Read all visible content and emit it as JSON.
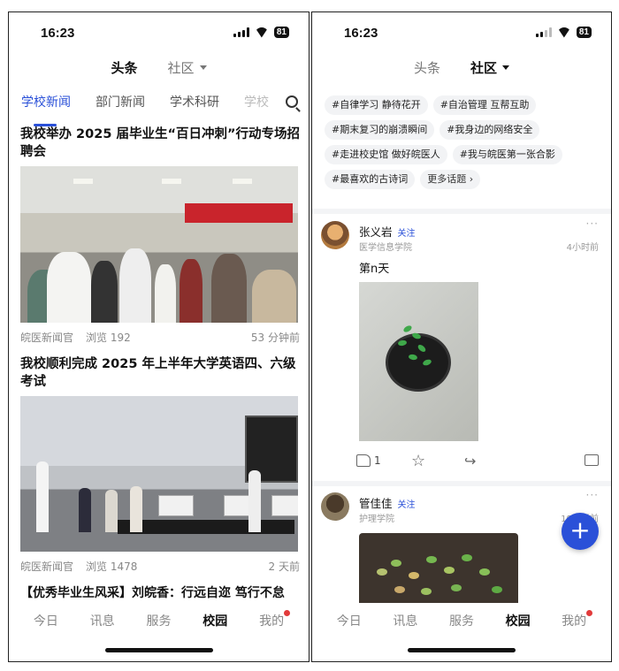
{
  "status_bar": {
    "time": "16:23",
    "battery": "81"
  },
  "left": {
    "top_tabs": [
      {
        "label": "头条"
      },
      {
        "label": "社区"
      }
    ],
    "sub_tabs": [
      {
        "label": "学校新闻"
      },
      {
        "label": "部门新闻"
      },
      {
        "label": "学术科研"
      },
      {
        "label": "学校"
      }
    ],
    "articles": [
      {
        "title": "我校举办 2025 届毕业生“百日冲刺”行动专场招聘会",
        "source": "皖医新闻官",
        "views": "浏览 192",
        "time": "53 分钟前"
      },
      {
        "title": "我校顺利完成 2025 年上半年大学英语四、六级考试",
        "source": "皖医新闻官",
        "views": "浏览 1478",
        "time": "2 天前"
      }
    ],
    "teaser": "【优秀毕业生风采】刘皖香：行远自迩  笃行不怠"
  },
  "right": {
    "top_tabs": [
      {
        "label": "头条"
      },
      {
        "label": "社区"
      }
    ],
    "tags": [
      "#自律学习 静待花开",
      "#自治管理 互帮互助",
      "#期末复习的崩溃瞬间",
      "#我身边的网络安全",
      "#走进校史馆 做好皖医人",
      "#我与皖医第一张合影",
      "#最喜欢的古诗词"
    ],
    "more_topics": "更多话题  ›",
    "posts": [
      {
        "name": "张义岩",
        "follow": "关注",
        "dept": "医学信息学院",
        "time": "4小时前",
        "content": "第n天",
        "likes": "1"
      },
      {
        "name": "管佳佳",
        "follow": "关注",
        "dept": "护理学院",
        "time": "19小时前"
      }
    ],
    "fab": "+"
  },
  "bottom_nav": [
    {
      "label": "今日"
    },
    {
      "label": "讯息"
    },
    {
      "label": "服务"
    },
    {
      "label": "校园"
    },
    {
      "label": "我的"
    }
  ],
  "colors": {
    "accent": "#2a50d8",
    "badge": "#e23b3b"
  }
}
